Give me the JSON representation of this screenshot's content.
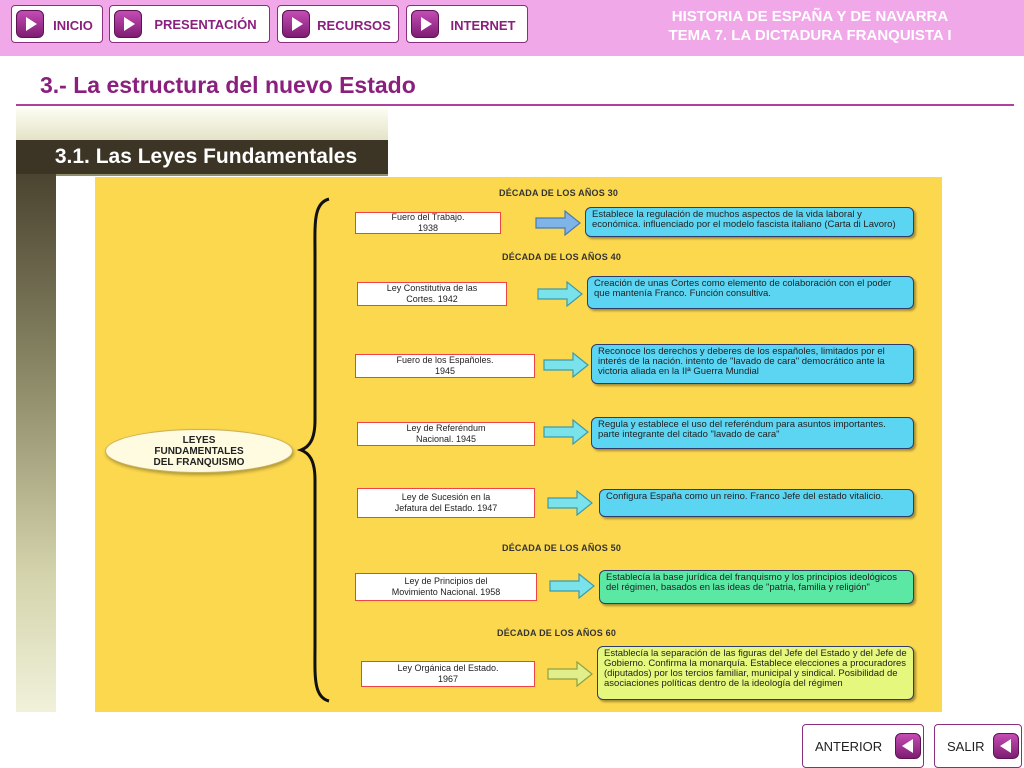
{
  "nav": {
    "buttons": [
      {
        "label": "INICIO"
      },
      {
        "label": "PRESENTACIÓN"
      },
      {
        "label": "RECURSOS"
      },
      {
        "label": "INTERNET"
      }
    ]
  },
  "header": {
    "title_line1": "HISTORIA DE ESPAÑA Y DE NAVARRA",
    "title_line2": "TEMA 7. LA DICTADURA FRANQUISTA I"
  },
  "section": {
    "title": "3.- La estructura del nuevo Estado",
    "subtitle": "3.1. Las Leyes Fundamentales"
  },
  "diagram": {
    "center_lines": [
      "LEYES",
      "FUNDAMENTALES",
      "DEL FRANQUISMO"
    ],
    "decades": [
      "DÉCADA  DE LOS AÑOS 30",
      "DÉCADA DE LOS AÑOS 40",
      "DÉCADA DE LOS AÑOS 50",
      "DÉCADA DE LOS AÑOS 60"
    ],
    "laws": [
      {
        "name_l1": "Fuero del Trabajo.",
        "name_l2": "1938",
        "desc": "Establece la regulación de muchos aspectos de la vida laboral y económica. influenciado por el modelo fascista italiano (Carta di Lavoro)",
        "color": "#5cd5f3"
      },
      {
        "name_l1": "Ley Constitutiva de las",
        "name_l2": "Cortes.   1942",
        "desc": "Creación de unas Cortes como elemento de colaboración con el poder que mantenía Franco. Función consultiva.",
        "color": "#5cd5f3"
      },
      {
        "name_l1": "Fuero de los Españoles.",
        "name_l2": "1945",
        "desc": "Reconoce los derechos y deberes de los españoles, limitados por el interés de la nación. intento de \"lavado de cara\" democrático ante la victoria aliada en la IIª Guerra Mundial",
        "color": "#5cd5f3"
      },
      {
        "name_l1": "Ley de Referéndum",
        "name_l2": "Nacional. 1945",
        "desc": "Regula y establece el uso del referéndum para asuntos importantes. parte integrante del citado \"lavado de cara\"",
        "color": "#5cd5f3"
      },
      {
        "name_l1": "Ley de Sucesión en la",
        "name_l2": "Jefatura del Estado. 1947",
        "desc": "Configura España como un reino. Franco Jefe del estado vitalicio.",
        "color": "#5cd5f3"
      },
      {
        "name_l1": "Ley de Principios del",
        "name_l2": "Movimiento Nacional. 1958",
        "desc": "Establecía la base jurídica del franquismo y los principios ideológicos del régimen, basados en las ideas de \"patria, familia y religión\"",
        "color": "#5be7a4"
      },
      {
        "name_l1": "Ley Orgánica del Estado.",
        "name_l2": "1967",
        "desc": "Establecía la separación de las figuras del Jefe del Estado y del Jefe de Gobierno. Confirma la monarquía. Establece elecciones a procuradores (diputados) por los tercios familiar, municipal y sindical. Posibilidad de asociaciones políticas dentro de la ideología del régimen",
        "color": "#e6f77d"
      }
    ]
  },
  "footer": {
    "prev_label": "ANTERIOR",
    "exit_label": "SALIR"
  },
  "colors": {
    "header_bg": "#f0a8e8",
    "accent": "#8a1f7e",
    "diagram_bg": "#fcd84e",
    "law_box_border": "#ee4444"
  },
  "icons": {
    "nav": "play-triangle-icon",
    "footer_prev": "back-triangle-icon",
    "connector": "right-arrow-icon",
    "grouping": "curly-brace-icon"
  }
}
